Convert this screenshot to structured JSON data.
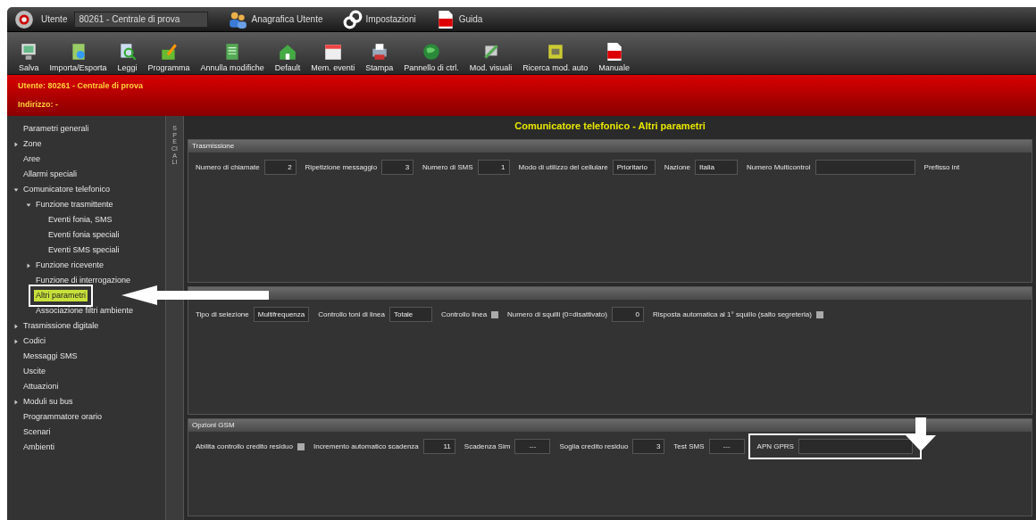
{
  "window": {
    "user_label": "Utente",
    "user_value": "80261 - Centrale di prova",
    "links": [
      "Anagrafica Utente",
      "Impostazioni",
      "Guida"
    ]
  },
  "toolbar": [
    "Salva",
    "Importa/Esporta",
    "Leggi",
    "Programma",
    "Annulla modifiche",
    "Default",
    "Mem. eventi",
    "Stampa",
    "Pannello di ctrl.",
    "Mod. visuali",
    "Ricerca mod. auto",
    "Manuale"
  ],
  "banner": {
    "user": "Utente: 80261 - Centrale di prova",
    "address": "Indirizzo: -"
  },
  "sidebar": {
    "tab": "SPECIALI",
    "items": [
      {
        "label": "Parametri generali",
        "selected": false
      },
      {
        "label": "Zone",
        "expanded": false,
        "selected": false
      },
      {
        "label": "Aree",
        "selected": false
      },
      {
        "label": "Allarmi speciali",
        "selected": false
      },
      {
        "label": "Comunicatore telefonico",
        "expanded": true,
        "selected": false,
        "children": [
          {
            "label": "Funzione trasmittente",
            "expanded": true,
            "selected": false,
            "children": [
              {
                "label": "Eventi fonia, SMS",
                "selected": false
              },
              {
                "label": "Eventi fonia speciali",
                "selected": false
              },
              {
                "label": "Eventi SMS speciali",
                "selected": false
              }
            ]
          },
          {
            "label": "Funzione ricevente",
            "expanded": false,
            "selected": false
          },
          {
            "label": "Funzione di interrogazione",
            "selected": false
          },
          {
            "label": "Altri parametri",
            "selected": true
          },
          {
            "label": "Associazione filtri ambiente",
            "selected": false
          }
        ]
      },
      {
        "label": "Trasmissione digitale",
        "expanded": false,
        "selected": false
      },
      {
        "label": "Codici",
        "expanded": false,
        "selected": false
      },
      {
        "label": "Messaggi SMS",
        "selected": false
      },
      {
        "label": "Uscite",
        "selected": false
      },
      {
        "label": "Attuazioni",
        "selected": false
      },
      {
        "label": "Moduli su bus",
        "expanded": false,
        "selected": false
      },
      {
        "label": "Programmatore orario",
        "selected": false
      },
      {
        "label": "Scenari",
        "selected": false
      },
      {
        "label": "Ambienti",
        "selected": false
      }
    ]
  },
  "page_title": "Comunicatore telefonico - Altri parametri",
  "sections": [
    {
      "title": "Trasmissione",
      "fields": [
        {
          "kind": "number",
          "label": "Numero di chiamate",
          "value": "2"
        },
        {
          "kind": "number",
          "label": "Ripetizione messaggio",
          "value": "3"
        },
        {
          "kind": "number",
          "label": "Numero di SMS",
          "value": "1"
        },
        {
          "kind": "select",
          "label": "Modo di utilizzo del cellulare",
          "value": "Prioritario"
        },
        {
          "kind": "select",
          "label": "Nazione",
          "value": "Italia"
        },
        {
          "kind": "text",
          "label": "Numero Multicontrol"
        },
        {
          "kind": "label",
          "label": "Prefisso int"
        }
      ]
    },
    {
      "fields": [
        {
          "kind": "select",
          "label": "Tipo di selezione",
          "value": "Multifrequenza"
        },
        {
          "kind": "select",
          "label": "Controllo toni di linea",
          "value": "Totale"
        },
        {
          "kind": "checkbox",
          "label": "Controllo linea",
          "checked": true
        },
        {
          "kind": "number",
          "label": "Numero di squilli (0=disattivato)",
          "value": "0"
        },
        {
          "kind": "checkbox",
          "label": "Risposta automatica al 1° squillo (salto segreteria)",
          "checked": true
        }
      ]
    },
    {
      "title": "Opzioni GSM",
      "fields": [
        {
          "kind": "checkbox",
          "label": "Abilita controllo credito residuo",
          "checked": true
        },
        {
          "kind": "number",
          "label": "Incremento automatico scadenza",
          "value": "11"
        },
        {
          "kind": "text",
          "label": "Scadenza Sim",
          "value": "---"
        },
        {
          "kind": "number",
          "label": "Soglia credito residuo",
          "value": "3"
        },
        {
          "kind": "text",
          "label": "Test SMS",
          "value": "---"
        },
        {
          "kind": "text",
          "label": "APN GPRS",
          "highlighted": true
        }
      ]
    }
  ]
}
